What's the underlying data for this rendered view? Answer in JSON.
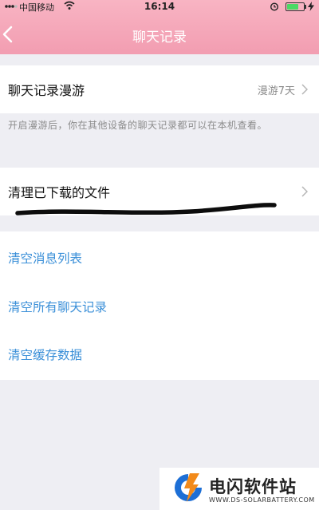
{
  "status_bar": {
    "carrier": "中国移动",
    "time": "16:14",
    "battery_level": 0.7
  },
  "header": {
    "title": "聊天记录",
    "back_icon": "back-chevron-icon"
  },
  "roaming": {
    "label": "聊天记录漫游",
    "value": "漫游7天",
    "description": "开启漫游后，你在其他设备的聊天记录都可以在本机查看。"
  },
  "cleanup": {
    "label": "清理已下载的文件"
  },
  "actions": [
    {
      "label": "清空消息列表"
    },
    {
      "label": "清空所有聊天记录"
    },
    {
      "label": "清空缓存数据"
    }
  ],
  "watermark": {
    "name": "电闪软件站",
    "url": "WWW.DS-SOLARBATTERY.COM"
  },
  "colors": {
    "header_pink": "#f29db1",
    "action_blue": "#3a8fd8",
    "background": "#eeeef3"
  }
}
